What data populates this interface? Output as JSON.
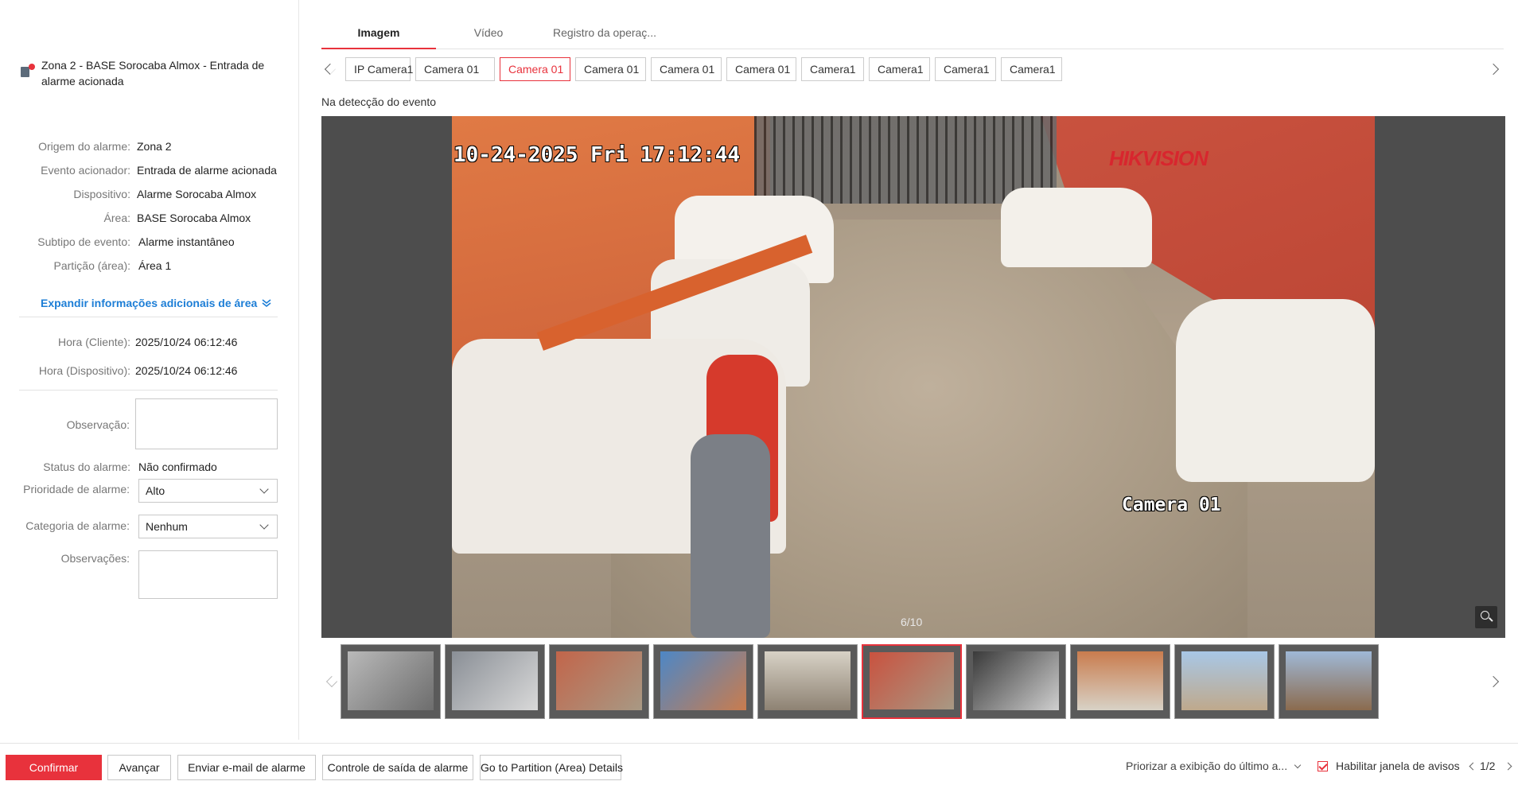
{
  "alarm": {
    "title": "Zona 2 - BASE Sorocaba Almox - Entrada de alarme acionada"
  },
  "details": [
    {
      "label": "Origem do alarme:",
      "value": "Zona 2"
    },
    {
      "label": "Evento acionador:",
      "value": "Entrada de alarme acionada"
    },
    {
      "label": "Dispositivo:",
      "value": "Alarme Sorocaba Almox"
    },
    {
      "label": "Área:",
      "value": "BASE Sorocaba Almox"
    },
    {
      "label": "Subtipo de evento:",
      "value": "Alarme instantâneo"
    },
    {
      "label": "Partição (área):",
      "value": "Área 1"
    }
  ],
  "expand_label": "Expandir informações adicionais de área",
  "times": [
    {
      "label": "Hora (Cliente):",
      "value": "2025/10/24 06:12:46"
    },
    {
      "label": "Hora (Dispositivo):",
      "value": "2025/10/24 06:12:46"
    }
  ],
  "form": {
    "observacao_label": "Observação:",
    "status_label": "Status do alarme:",
    "status_value": "Não confirmado",
    "priority_label": "Prioridade de alarme:",
    "priority_value": "Alto",
    "category_label": "Categoria de alarme:",
    "category_value": "Nenhum",
    "observacoes_label": "Observações:"
  },
  "tabs": [
    "Imagem",
    "Vídeo",
    "Registro da operaç..."
  ],
  "cameras": [
    "IP Camera1",
    "Camera 01",
    "Camera 01",
    "Camera 01",
    "Camera 01",
    "Camera 01",
    "Camera1",
    "Camera1",
    "Camera1",
    "Camera1"
  ],
  "active_camera_index": 2,
  "detect_label": "Na detecção do evento",
  "viewer": {
    "osd_time": "10-24-2025 Fri 17:12:44",
    "osd_logo": "HIKVISION",
    "osd_camera": "Camera 01",
    "counter": "6/10"
  },
  "thumbnails_count": 10,
  "active_thumbnail": 5,
  "bottom": {
    "confirm": "Confirmar",
    "advance": "Avançar",
    "email": "Enviar e-mail de alarme",
    "output": "Controle de saída de alarme",
    "partition": "Go to Partition (Area) Details",
    "priority_select": "Priorizar a exibição do último a...",
    "enable_popup": "Habilitar janela de avisos",
    "pager": "1/2"
  },
  "colors": {
    "accent": "#e8323c",
    "link": "#1d7ed6"
  }
}
